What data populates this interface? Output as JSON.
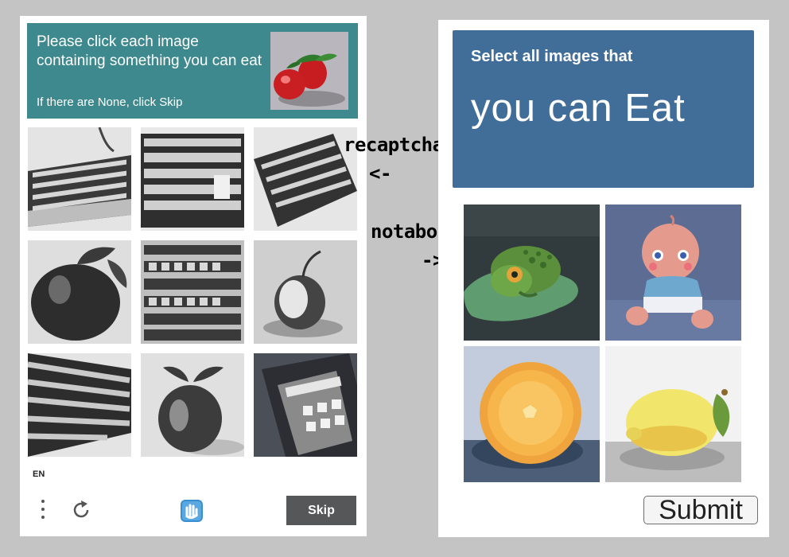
{
  "recaptcha": {
    "title": "Please click each image containing something you can eat",
    "subtitle": "If there are None, click Skip",
    "language": "EN",
    "skip_label": "Skip",
    "header_color": "#3d898d",
    "tiles": [
      "keyboard",
      "keyboard",
      "keyboard",
      "apple",
      "keyboard",
      "apple",
      "keyboard",
      "apple",
      "phone"
    ]
  },
  "annotations": {
    "recaptcha_label": "recaptcha",
    "recaptcha_arrow": "<-",
    "notabot_label": "notabot",
    "notabot_arrow": "->"
  },
  "notabot": {
    "line1": "Select all images that",
    "line2": "you can Eat",
    "submit_label": "Submit",
    "header_color": "#416e99",
    "tiles": [
      "frog",
      "baby",
      "orange",
      "lemon"
    ]
  }
}
